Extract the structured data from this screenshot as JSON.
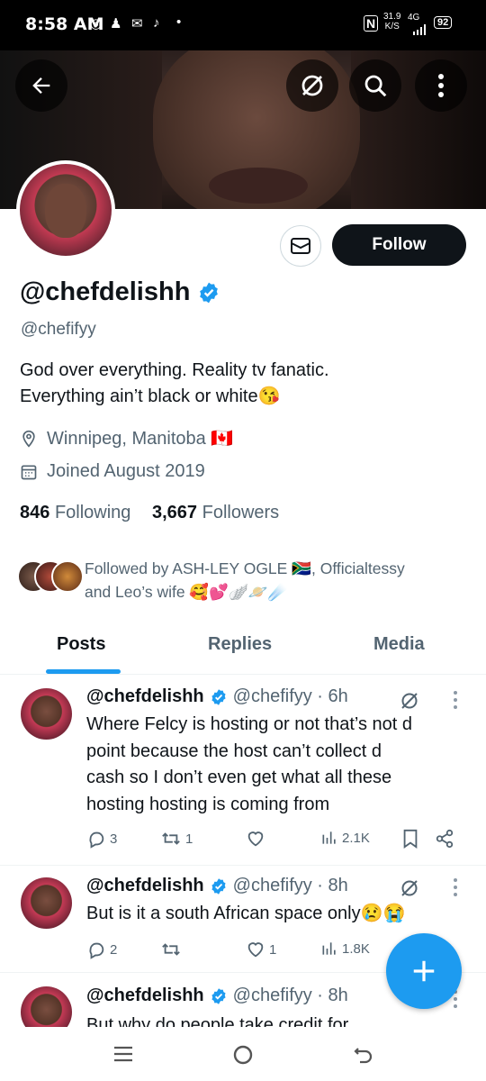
{
  "status": {
    "time": "8:58 AM",
    "speed": "31.9",
    "speed_unit": "K/S",
    "network": "4G",
    "battery": "92"
  },
  "header": {
    "back_icon": "back-arrow-icon",
    "grok_icon": "grok-icon",
    "search_icon": "search-icon",
    "more_icon": "more-vertical-icon"
  },
  "profile": {
    "display_name": "@chefdelishh",
    "handle": "@chefifyy",
    "bio_line1": "God over everything. Reality tv fanatic.",
    "bio_line2": "Everything ain’t black or white😘",
    "location": "Winnipeg, Manitoba 🇨🇦",
    "joined": "Joined August 2019",
    "following_count": "846",
    "following_label": "Following",
    "followers_count": "3,667",
    "followers_label": "Followers",
    "followed_by_line1": "Followed by ASH-LEY OGLE 🇿🇦, Officialtessy",
    "followed_by_line2": "and Leo’s wife 🥰💕🪽🪐☄️",
    "follow_label": "Follow",
    "verified_color": "#1d9bf0"
  },
  "tabs": [
    {
      "label": "Posts"
    },
    {
      "label": "Replies"
    },
    {
      "label": "Media"
    }
  ],
  "posts": [
    {
      "name": "@chefdelishh",
      "handle": "@chefifyy · 6h",
      "lines": [
        "Where Felcy is hosting or not that’s not d",
        "point because the host can’t collect d",
        "cash so I don’t even get what all these",
        "hosting hosting is coming from"
      ],
      "replies": "3",
      "reposts": "1",
      "likes": "",
      "views": "2.1K"
    },
    {
      "name": "@chefdelishh",
      "handle": "@chefifyy · 8h",
      "lines": [
        "But is it a south African space only😢😭"
      ],
      "replies": "2",
      "reposts": "",
      "likes": "1",
      "views": "1.8K"
    },
    {
      "name": "@chefdelishh",
      "handle": "@chefifyy · 8h",
      "lines": [
        "But why do people take credit for"
      ]
    }
  ],
  "fab": {
    "icon": "plus-icon"
  },
  "accent": "#1d9bf0"
}
